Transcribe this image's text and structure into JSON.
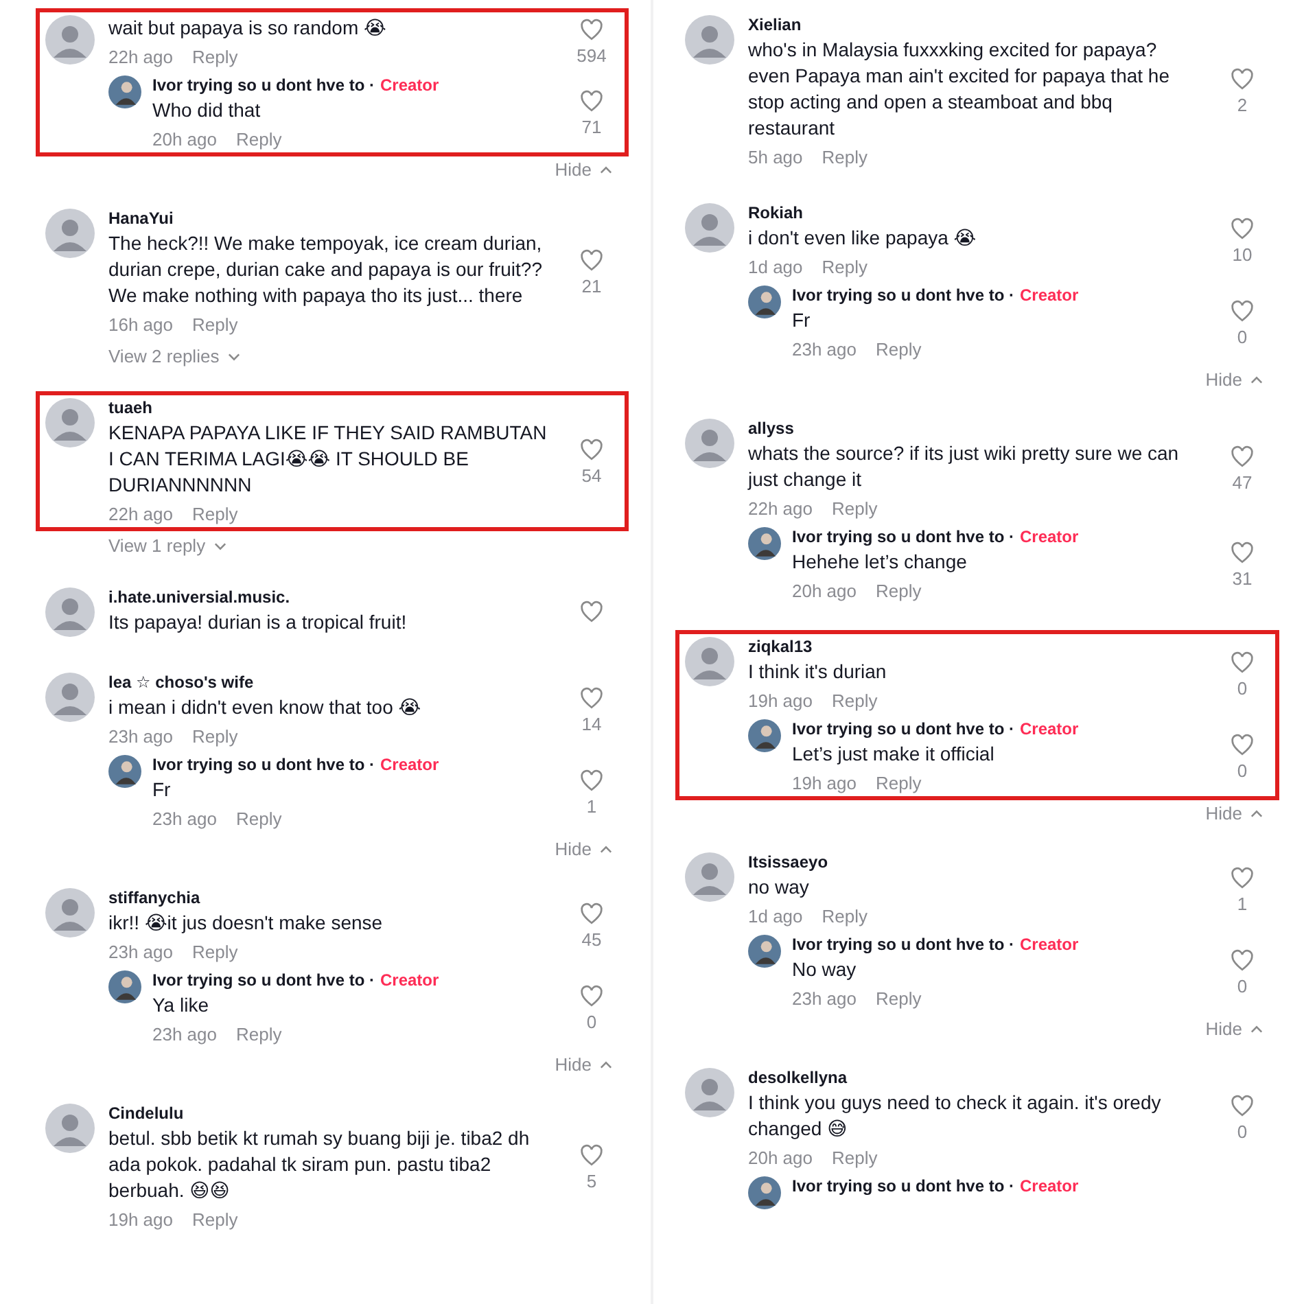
{
  "columns": [
    {
      "comments": [
        {
          "text": "wait but papaya is so random 😭",
          "time": "22h ago",
          "reply_label": "Reply",
          "likes": "594",
          "highlighted": true,
          "replies": [
            {
              "author": "Ivor trying so u dont hve to ·",
              "badge": "Creator",
              "text": "Who did that",
              "time": "20h ago",
              "reply_label": "Reply",
              "likes": "71"
            }
          ],
          "toggle": {
            "label": "Hide",
            "expanded": true
          }
        },
        {
          "name": "HanaYui",
          "text": "The heck?!! We make tempoyak, ice cream durian, durian crepe, durian cake and papaya is our fruit?? We make nothing with papaya tho its just... there",
          "time": "16h ago",
          "reply_label": "Reply",
          "likes": "21",
          "highlighted": false,
          "toggle": {
            "label": "View 2 replies",
            "expanded": false
          }
        },
        {
          "name": "tuaeh",
          "text": "KENAPA PAPAYA LIKE IF THEY SAID RAMBUTAN I CAN TERIMA LAGI😭😭 IT SHOULD BE DURIANNNNNN",
          "time": "22h ago",
          "reply_label": "Reply",
          "likes": "54",
          "highlighted": true,
          "toggle": {
            "label": "View 1 reply",
            "expanded": false
          }
        },
        {
          "name": "i.hate.universial.music.",
          "text": "Its papaya! durian is a tropical fruit!",
          "highlighted": false
        },
        {
          "name": "lea ☆ choso's wife",
          "text": "i mean i didn't even know that too 😭",
          "time": "23h ago",
          "reply_label": "Reply",
          "likes": "14",
          "highlighted": false,
          "replies": [
            {
              "author": "Ivor trying so u dont hve to ·",
              "badge": "Creator",
              "text": "Fr",
              "time": "23h ago",
              "reply_label": "Reply",
              "likes": "1"
            }
          ],
          "toggle": {
            "label": "Hide",
            "expanded": true
          }
        },
        {
          "name": "stiffanychia",
          "text": "ikr!! 😭it jus doesn't make sense",
          "time": "23h ago",
          "reply_label": "Reply",
          "likes": "45",
          "highlighted": false,
          "replies": [
            {
              "author": "Ivor trying so u dont hve to ·",
              "badge": "Creator",
              "text": "Ya like",
              "time": "23h ago",
              "reply_label": "Reply",
              "likes": "0"
            }
          ],
          "toggle": {
            "label": "Hide",
            "expanded": true
          }
        },
        {
          "name": "Cindelulu",
          "text": "betul. sbb betik kt rumah sy buang biji je. tiba2 dh ada pokok. padahal tk siram pun. pastu tiba2 berbuah. 😆😆",
          "time": "19h ago",
          "reply_label": "Reply",
          "likes": "5",
          "highlighted": false
        }
      ]
    },
    {
      "comments": [
        {
          "name": "Xielian",
          "text": "who's in Malaysia fuxxxking excited for papaya? even Papaya man ain't excited for papaya that he stop acting and open a steamboat and bbq restaurant",
          "time": "5h ago",
          "reply_label": "Reply",
          "likes": "2",
          "highlighted": false
        },
        {
          "name": "Rokiah",
          "text": "i don't even like papaya 😭",
          "time": "1d ago",
          "reply_label": "Reply",
          "likes": "10",
          "highlighted": false,
          "replies": [
            {
              "author": "Ivor trying so u dont hve to ·",
              "badge": "Creator",
              "text": "Fr",
              "time": "23h ago",
              "reply_label": "Reply",
              "likes": "0"
            }
          ],
          "toggle": {
            "label": "Hide",
            "expanded": true
          }
        },
        {
          "name": "allyss",
          "text": "whats the source? if its just wiki pretty sure we can just change it",
          "time": "22h ago",
          "reply_label": "Reply",
          "likes": "47",
          "highlighted": false,
          "replies": [
            {
              "author": "Ivor trying so u dont hve to ·",
              "badge": "Creator",
              "text": "Hehehe let’s change",
              "time": "20h ago",
              "reply_label": "Reply",
              "likes": "31"
            }
          ]
        },
        {
          "name": "ziqkal13",
          "text": "I think it's durian",
          "time": "19h ago",
          "reply_label": "Reply",
          "likes": "0",
          "highlighted": true,
          "replies": [
            {
              "author": "Ivor trying so u dont hve to ·",
              "badge": "Creator",
              "text": "Let’s just make it official",
              "time": "19h ago",
              "reply_label": "Reply",
              "likes": "0"
            }
          ],
          "toggle": {
            "label": "Hide",
            "expanded": true
          }
        },
        {
          "name": "Itsissaeyo",
          "text": "no way",
          "time": "1d ago",
          "reply_label": "Reply",
          "likes": "1",
          "highlighted": false,
          "replies": [
            {
              "author": "Ivor trying so u dont hve to ·",
              "badge": "Creator",
              "text": "No way",
              "time": "23h ago",
              "reply_label": "Reply",
              "likes": "0"
            }
          ],
          "toggle": {
            "label": "Hide",
            "expanded": true
          }
        },
        {
          "name": "desolkellyna",
          "text": "I think you guys need to check it again. it's oredy changed 😅",
          "time": "20h ago",
          "reply_label": "Reply",
          "likes": "0",
          "highlighted": false,
          "replies": [
            {
              "author": "Ivor trying so u dont hve to ·",
              "badge": "Creator"
            }
          ]
        }
      ]
    }
  ]
}
